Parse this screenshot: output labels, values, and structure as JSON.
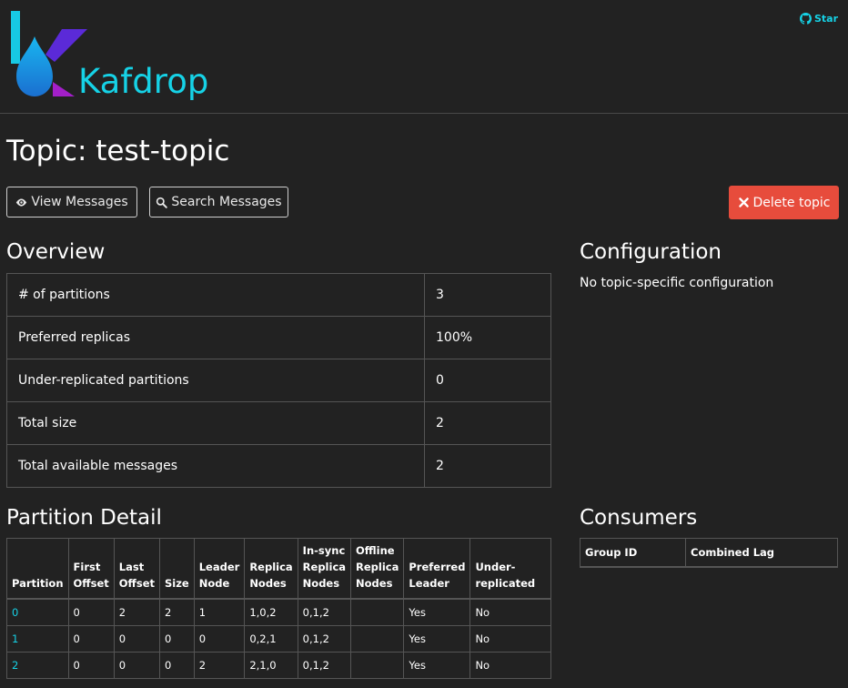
{
  "header": {
    "brand": "Kafdrop",
    "star_label": "Star"
  },
  "page": {
    "title": "Topic: test-topic"
  },
  "actions": {
    "view_messages": "View Messages",
    "search_messages": "Search Messages",
    "delete_topic": "Delete topic"
  },
  "overview": {
    "title": "Overview",
    "rows": [
      {
        "label": "# of partitions",
        "value": "3"
      },
      {
        "label": "Preferred replicas",
        "value": "100%"
      },
      {
        "label": "Under-replicated partitions",
        "value": "0"
      },
      {
        "label": "Total size",
        "value": "2"
      },
      {
        "label": "Total available messages",
        "value": "2"
      }
    ]
  },
  "configuration": {
    "title": "Configuration",
    "text": "No topic-specific configuration"
  },
  "partition_detail": {
    "title": "Partition Detail",
    "headers": [
      "Partition",
      "First Offset",
      "Last Offset",
      "Size",
      "Leader Node",
      "Replica Nodes",
      "In-sync Replica Nodes",
      "Offline Replica Nodes",
      "Preferred Leader",
      "Under-replicated"
    ],
    "rows": [
      [
        "0",
        "0",
        "2",
        "2",
        "1",
        "1,0,2",
        "0,1,2",
        "",
        "Yes",
        "No"
      ],
      [
        "1",
        "0",
        "0",
        "0",
        "0",
        "0,2,1",
        "0,1,2",
        "",
        "Yes",
        "No"
      ],
      [
        "2",
        "0",
        "0",
        "0",
        "2",
        "2,1,0",
        "0,1,2",
        "",
        "Yes",
        "No"
      ]
    ]
  },
  "consumers": {
    "title": "Consumers",
    "headers": [
      "Group ID",
      "Combined Lag"
    ]
  },
  "colors": {
    "background": "#222222",
    "accent": "#16d2e6",
    "danger": "#e74c3c"
  }
}
